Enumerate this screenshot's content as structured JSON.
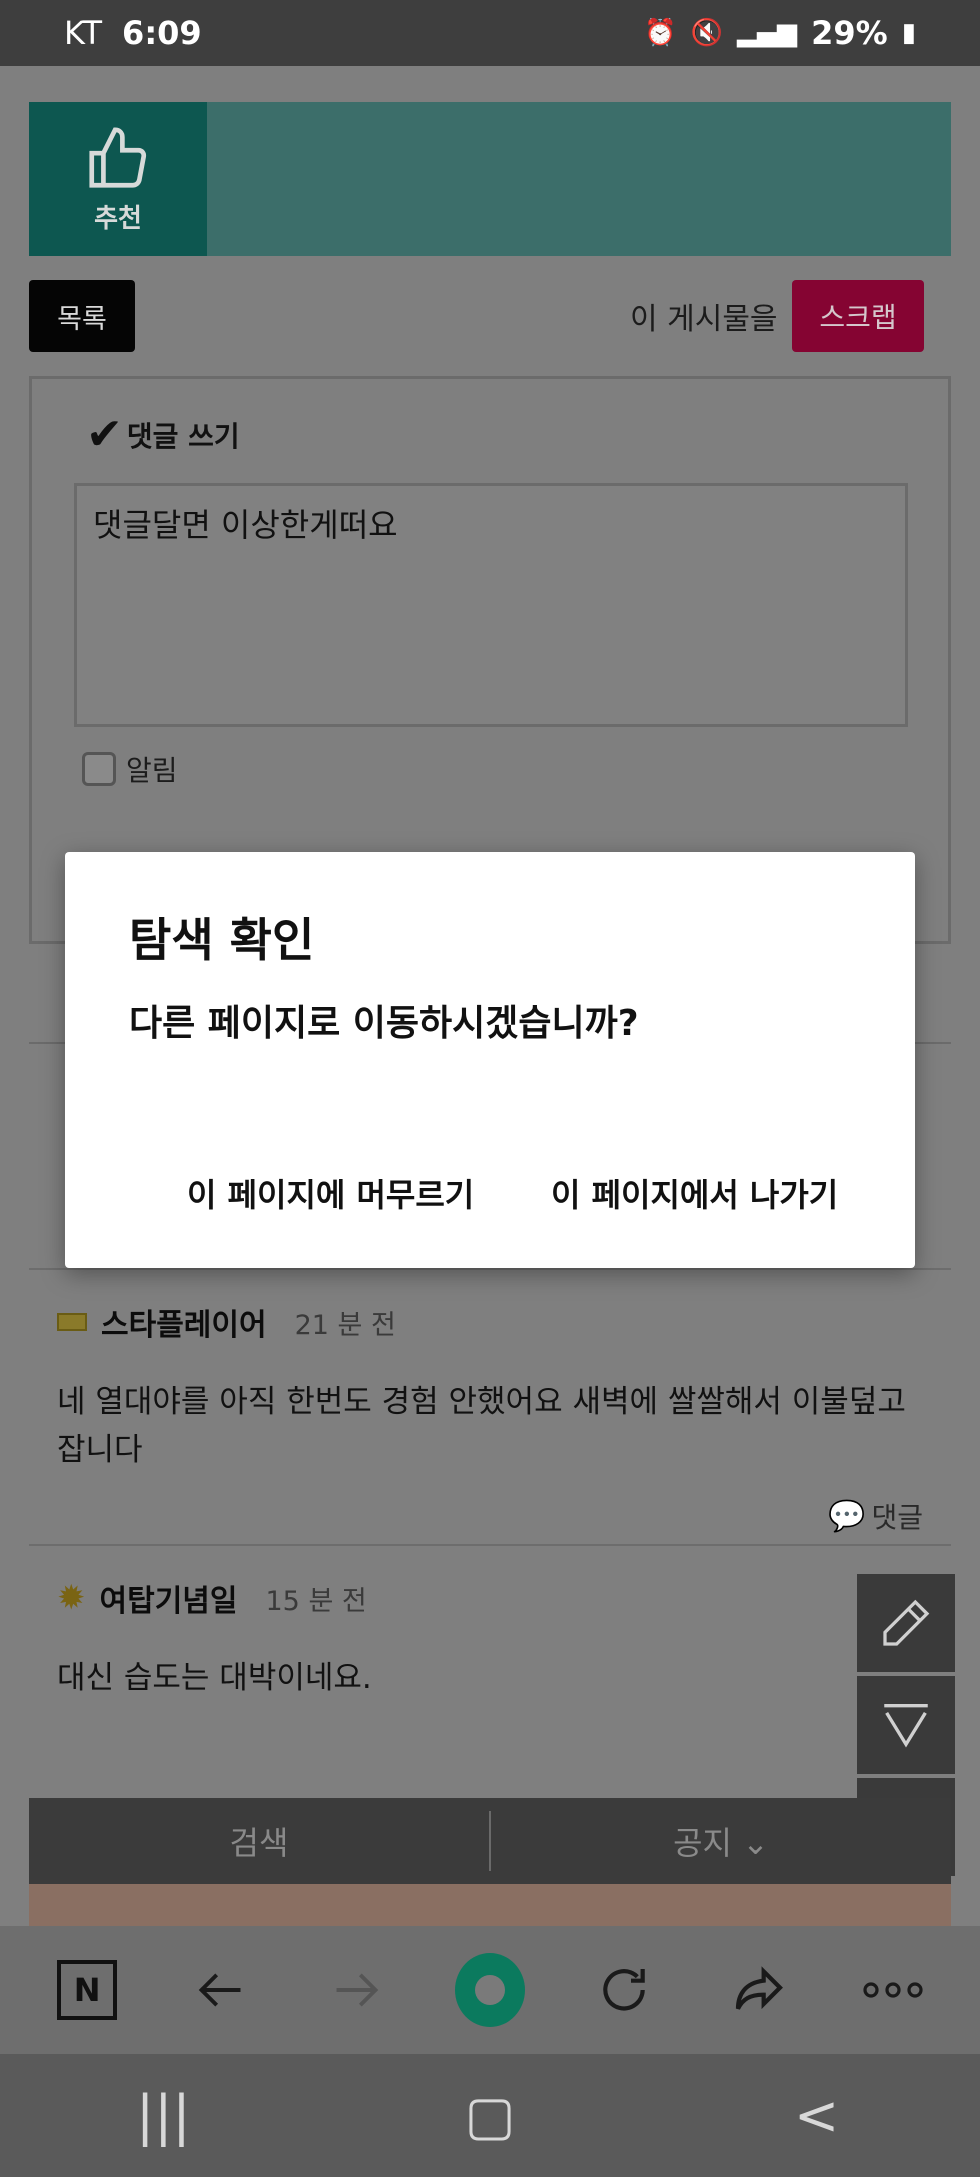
{
  "status_bar": {
    "carrier": "KT",
    "time": "6:09",
    "battery": "29%"
  },
  "post": {
    "recommend_label": "추천",
    "list_button": "목록",
    "post_label": "이 게시물을",
    "scrap_button": "스크랩"
  },
  "comment_form": {
    "title": "댓글 쓰기",
    "text": "댓글달면 이상한게떠요",
    "notify_label": "알림"
  },
  "comments": [
    {
      "author": "스타플레이어",
      "time": "21 분 전",
      "text": "네 열대야를 아직 한번도 경험 안했어요 새벽에 쌀쌀해서 이불덮고 잡니다",
      "reply_label": "댓글"
    },
    {
      "author": "여탑기념일",
      "time": "15 분 전",
      "text": "대신 습도는 대박이네요."
    }
  ],
  "bottom_tabs": {
    "search": "검색",
    "notice": "공지"
  },
  "dialog": {
    "title": "탐색 확인",
    "message": "다른 페이지로 이동하시겠습니까?",
    "stay_button": "이 페이지에 머무르기",
    "leave_button": "이 페이지에서 나가기"
  },
  "browser_toolbar": {
    "n_label": "N"
  },
  "icons": [
    "thumbs-up-icon",
    "check-icon",
    "pencil-icon",
    "scroll-down-icon",
    "scroll-up-icon",
    "back-arrow-icon",
    "forward-arrow-icon",
    "refresh-icon",
    "share-icon",
    "more-icon",
    "recent-apps-icon",
    "home-icon",
    "nav-back-icon"
  ]
}
